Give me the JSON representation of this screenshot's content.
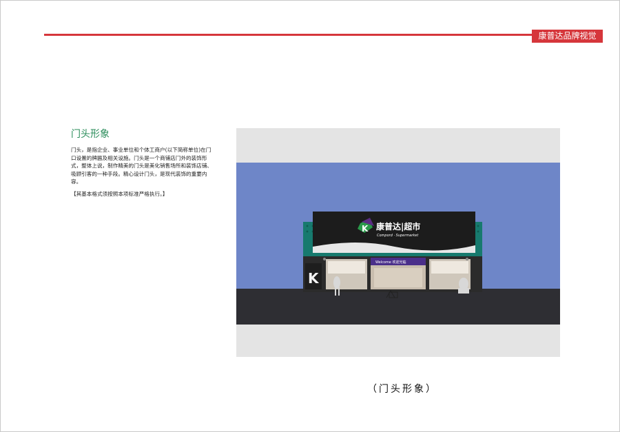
{
  "header": {
    "brand_tab": "康普达品牌视觉",
    "accent_color": "#d6363b"
  },
  "section": {
    "title": "门头形象",
    "body": "门头，是指企业、事业单位和个体工商户(以下简称单位)在门口设置的牌匾及相关设施。门头是一个商铺店门外的装饰形式，整体上说，制作精美的门头是美化销售场所和装饰店铺、吸顾引客的一种手段。精心设计门头，是现代装饰的重要内容。",
    "note": "【其基本格式须按照本项标准严格执行。】"
  },
  "storefront": {
    "sign_name": "康普达|超市",
    "sign_sub": "Compord · Supermarket",
    "logo_letter": "K",
    "welcome_text": "Welcome 欢迎光临",
    "sky_color": "#6e86c8",
    "awning_color": "#177a6e"
  },
  "caption": "（门头形象）"
}
